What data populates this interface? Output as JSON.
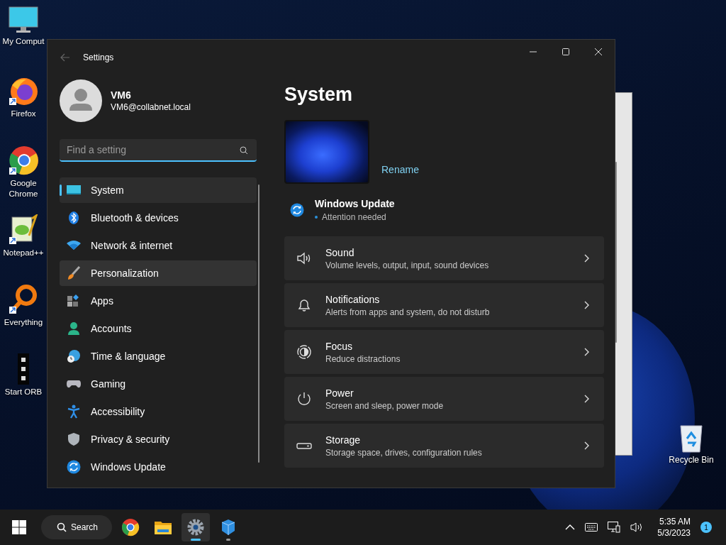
{
  "desktop_icons": [
    {
      "kind": "computer",
      "label": "My Comput"
    },
    {
      "kind": "firefox",
      "label": "Firefox"
    },
    {
      "kind": "chrome",
      "label": "Google Chrome"
    },
    {
      "kind": "notepad",
      "label": "Notepad++"
    },
    {
      "kind": "magnifier",
      "label": "Everything"
    },
    {
      "kind": "orb",
      "label": "Start ORB"
    }
  ],
  "recycle_bin": {
    "label": "Recycle Bin"
  },
  "window": {
    "title": "Settings",
    "user": {
      "name": "VM6",
      "email": "VM6@collabnet.local"
    },
    "search": {
      "placeholder": "Find a setting"
    },
    "nav": [
      {
        "kind": "system",
        "label": "System",
        "selected": true,
        "hovered": false
      },
      {
        "kind": "bluetooth",
        "label": "Bluetooth & devices",
        "selected": false,
        "hovered": false
      },
      {
        "kind": "network",
        "label": "Network & internet",
        "selected": false,
        "hovered": false
      },
      {
        "kind": "brush",
        "label": "Personalization",
        "selected": false,
        "hovered": true
      },
      {
        "kind": "apps",
        "label": "Apps",
        "selected": false,
        "hovered": false
      },
      {
        "kind": "accounts",
        "label": "Accounts",
        "selected": false,
        "hovered": false
      },
      {
        "kind": "time",
        "label": "Time & language",
        "selected": false,
        "hovered": false
      },
      {
        "kind": "gaming",
        "label": "Gaming",
        "selected": false,
        "hovered": false
      },
      {
        "kind": "accessibility",
        "label": "Accessibility",
        "selected": false,
        "hovered": false
      },
      {
        "kind": "privacy",
        "label": "Privacy & security",
        "selected": false,
        "hovered": false
      },
      {
        "kind": "update",
        "label": "Windows Update",
        "selected": false,
        "hovered": false
      }
    ],
    "heading": "System",
    "rename": "Rename",
    "update": {
      "title": "Windows Update",
      "status": "Attention needed"
    },
    "cards": [
      {
        "kind": "sound",
        "title": "Sound",
        "subtitle": "Volume levels, output, input, sound devices"
      },
      {
        "kind": "bell",
        "title": "Notifications",
        "subtitle": "Alerts from apps and system, do not disturb"
      },
      {
        "kind": "focus",
        "title": "Focus",
        "subtitle": "Reduce distractions"
      },
      {
        "kind": "power",
        "title": "Power",
        "subtitle": "Screen and sleep, power mode"
      },
      {
        "kind": "storage",
        "title": "Storage",
        "subtitle": "Storage space, drives, configuration rules"
      }
    ]
  },
  "taskbar": {
    "search": "Search",
    "apps": [
      {
        "kind": "chrome",
        "active": false,
        "running": false
      },
      {
        "kind": "folder",
        "active": false,
        "running": false
      },
      {
        "kind": "gear",
        "active": true,
        "running": true
      },
      {
        "kind": "cubes",
        "active": false,
        "running": true
      }
    ],
    "time": "5:35 AM",
    "date": "5/3/2023",
    "notifications": "1"
  }
}
